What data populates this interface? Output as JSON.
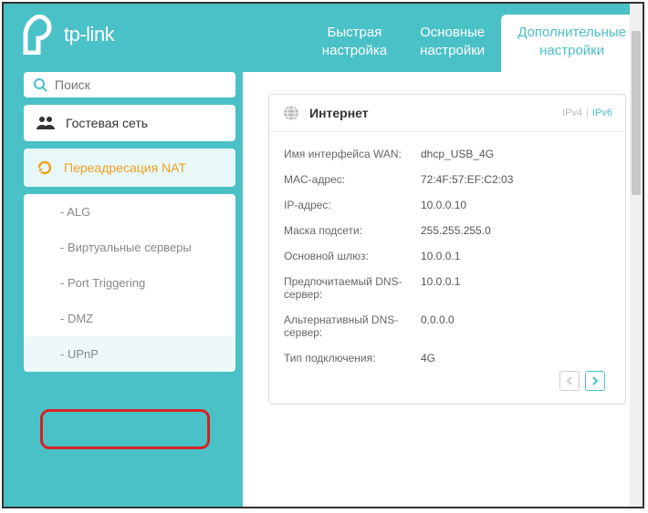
{
  "brand": "tp-link",
  "tabs": {
    "quick": "Быстрая\nнастройка",
    "basic": "Основные\nнастройки",
    "advanced": "Дополнительные\nнастройки"
  },
  "search": {
    "placeholder": "Поиск"
  },
  "sidebar": {
    "guest": "Гостевая сеть",
    "nat": "Переадресация NAT",
    "subs": {
      "alg": "- ALG",
      "vservers": "- Виртуальные серверы",
      "pt": "- Port Triggering",
      "dmz": "- DMZ",
      "upnp": "- UPnP"
    }
  },
  "panel": {
    "title": "Интернет",
    "ipv4": "IPv4",
    "ipv6": "IPv6",
    "rows": {
      "iface_l": "Имя интерфейса WAN:",
      "iface_v": "dhcp_USB_4G",
      "mac_l": "MAC-адрес:",
      "mac_v": "72:4F:57:EF:C2:03",
      "ip_l": "IP-адрес:",
      "ip_v": "10.0.0.10",
      "mask_l": "Маска подсети:",
      "mask_v": "255.255.255.0",
      "gw_l": "Основной шлюз:",
      "gw_v": "10.0.0.1",
      "dns1_l": "Предпочитаемый DNS-сервер:",
      "dns1_v": "10.0.0.1",
      "dns2_l": "Альтернативный DNS-сервер:",
      "dns2_v": "0.0.0.0",
      "conn_l": "Тип подключения:",
      "conn_v": "4G"
    }
  }
}
